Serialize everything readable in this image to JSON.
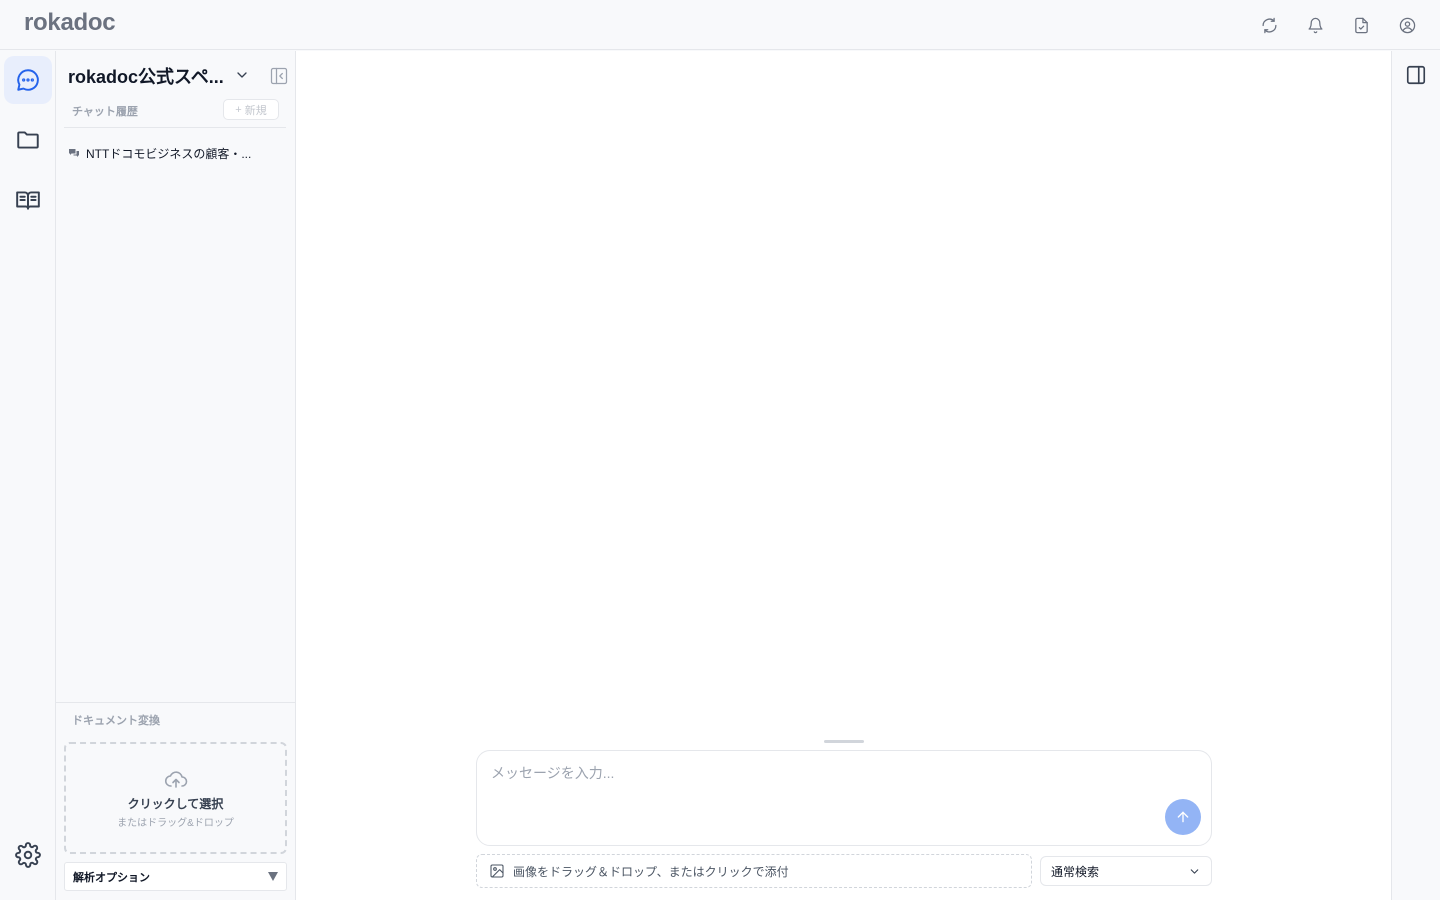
{
  "app": {
    "logo": "rokadoc"
  },
  "header": {
    "icons": [
      "refresh-icon",
      "bell-icon",
      "document-icon",
      "user-circle-icon"
    ]
  },
  "rail": {
    "items": [
      {
        "name": "chat",
        "icon": "chat-bubble-icon",
        "active": true
      },
      {
        "name": "folders",
        "icon": "folder-icon",
        "active": false
      },
      {
        "name": "library",
        "icon": "book-open-icon",
        "active": false
      }
    ],
    "settings_icon": "gear-icon"
  },
  "sidebar": {
    "workspace_title": "rokadoc公式スペ...",
    "chat_history_label": "チャット履歴",
    "new_button_icon": "+",
    "new_button_label": "新規",
    "chats": [
      {
        "title": "NTTドコモビジネスの顧客・..."
      }
    ],
    "doc_convert_label": "ドキュメント変換",
    "dropzone": {
      "main": "クリックして選択",
      "sub": "またはドラッグ&ドロップ"
    },
    "parse_options_label": "解析オプション"
  },
  "composer": {
    "placeholder": "メッセージを入力...",
    "attach_label": "画像をドラッグ＆ドロップ、またはクリックで添付",
    "search_mode": "通常検索"
  },
  "colors": {
    "accent": "#2563eb",
    "active_bg": "#e8eefc",
    "send_button": "#93b4f5",
    "border": "#e5e7eb"
  }
}
